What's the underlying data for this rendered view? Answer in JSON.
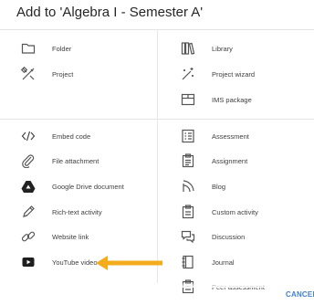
{
  "dialog": {
    "title": "Add to 'Algebra I - Semester A'",
    "cancel_label": "CANCEL"
  },
  "left_top": [
    {
      "label": "Folder",
      "icon": "folder-icon"
    },
    {
      "label": "Project",
      "icon": "project-tools-icon"
    }
  ],
  "right_top": [
    {
      "label": "Library",
      "icon": "library-icon"
    },
    {
      "label": "Project wizard",
      "icon": "magic-wand-icon"
    },
    {
      "label": "IMS package",
      "icon": "package-box-icon"
    }
  ],
  "left_bottom": [
    {
      "label": "Embed code",
      "icon": "code-icon"
    },
    {
      "label": "File attachment",
      "icon": "paperclip-icon"
    },
    {
      "label": "Google Drive document",
      "icon": "google-drive-icon"
    },
    {
      "label": "Rich-text activity",
      "icon": "pencil-icon"
    },
    {
      "label": "Website link",
      "icon": "link-icon"
    },
    {
      "label": "YouTube video",
      "icon": "youtube-icon"
    }
  ],
  "right_bottom": [
    {
      "label": "Assessment",
      "icon": "assessment-icon"
    },
    {
      "label": "Assignment",
      "icon": "assignment-icon"
    },
    {
      "label": "Blog",
      "icon": "blog-icon"
    },
    {
      "label": "Custom activity",
      "icon": "custom-activity-icon"
    },
    {
      "label": "Discussion",
      "icon": "discussion-icon"
    },
    {
      "label": "Journal",
      "icon": "journal-icon"
    },
    {
      "label": "Peer assessment",
      "icon": "peer-assessment-icon"
    }
  ],
  "colors": {
    "arrow": "#f2ac1c",
    "cancel": "#3f7fd0",
    "icon": "#555555"
  }
}
